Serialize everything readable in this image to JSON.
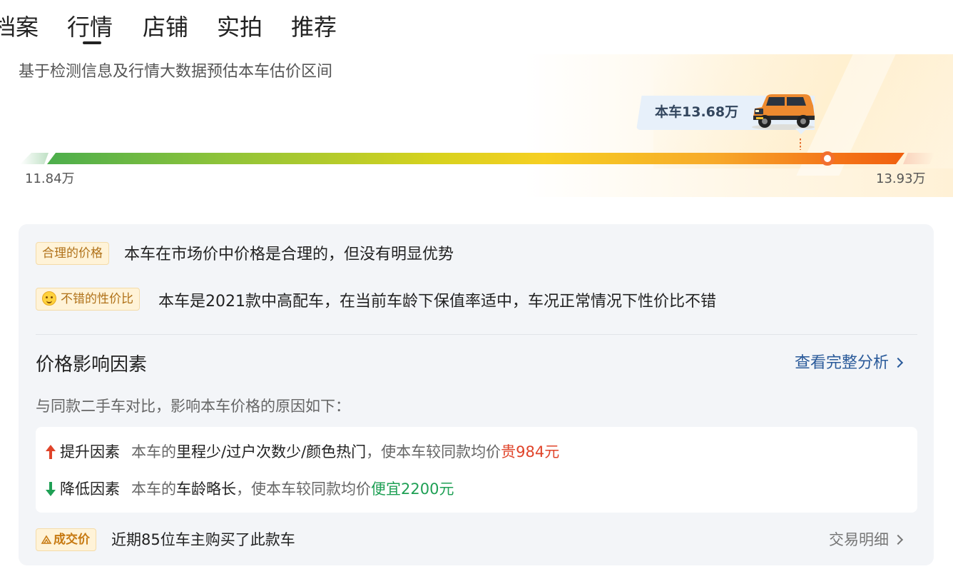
{
  "tabs": [
    {
      "label": "档案"
    },
    {
      "label": "行情"
    },
    {
      "label": "店铺"
    },
    {
      "label": "实拍"
    },
    {
      "label": "推荐"
    }
  ],
  "active_tab_index": 1,
  "header": {
    "subtitle": "基于检测信息及行情大数据预估本车估价区间",
    "current_price_label": "本车13.68万",
    "car_icon": "orange-suv-image",
    "range_low": "11.84万",
    "range_high": "13.93万",
    "price_position_fraction": 0.91
  },
  "colors": {
    "bar_start": "#4cae4c",
    "bar_mid": "#f6cf22",
    "bar_end": "#f0600f",
    "marker": "#f26f2f",
    "link": "#2a5a9a",
    "raise": "#e0442a",
    "lower": "#1fa055"
  },
  "assessment": {
    "reasonable_tag": "合理的价格",
    "reasonable_text": "本车在市场价中价格是合理的，但没有明显优势",
    "value_tag_icon": "smile-face-icon",
    "value_tag": "不错的性价比",
    "value_text": "本车是2021款中高配车，在当前车龄下保值率适中，车况正常情况下性价比不错"
  },
  "factors": {
    "title": "价格影响因素",
    "full_analysis_link": "查看完整分析",
    "compare_note": "与同款二手车对比，影响本车价格的原因如下：",
    "raise": {
      "label": "提升因素",
      "prefix": "本车的",
      "items": "里程少/过户次数少/颜色热门",
      "middle": "，使本车较同款均价",
      "effect": "贵984元"
    },
    "lower": {
      "label": "降低因素",
      "prefix": "本车的",
      "items": "车龄略长",
      "middle": "，使本车较同款均价",
      "effect": "便宜2200元"
    }
  },
  "deals": {
    "tag": "成交价",
    "text": "近期85位车主购买了此款车",
    "link": "交易明细"
  }
}
